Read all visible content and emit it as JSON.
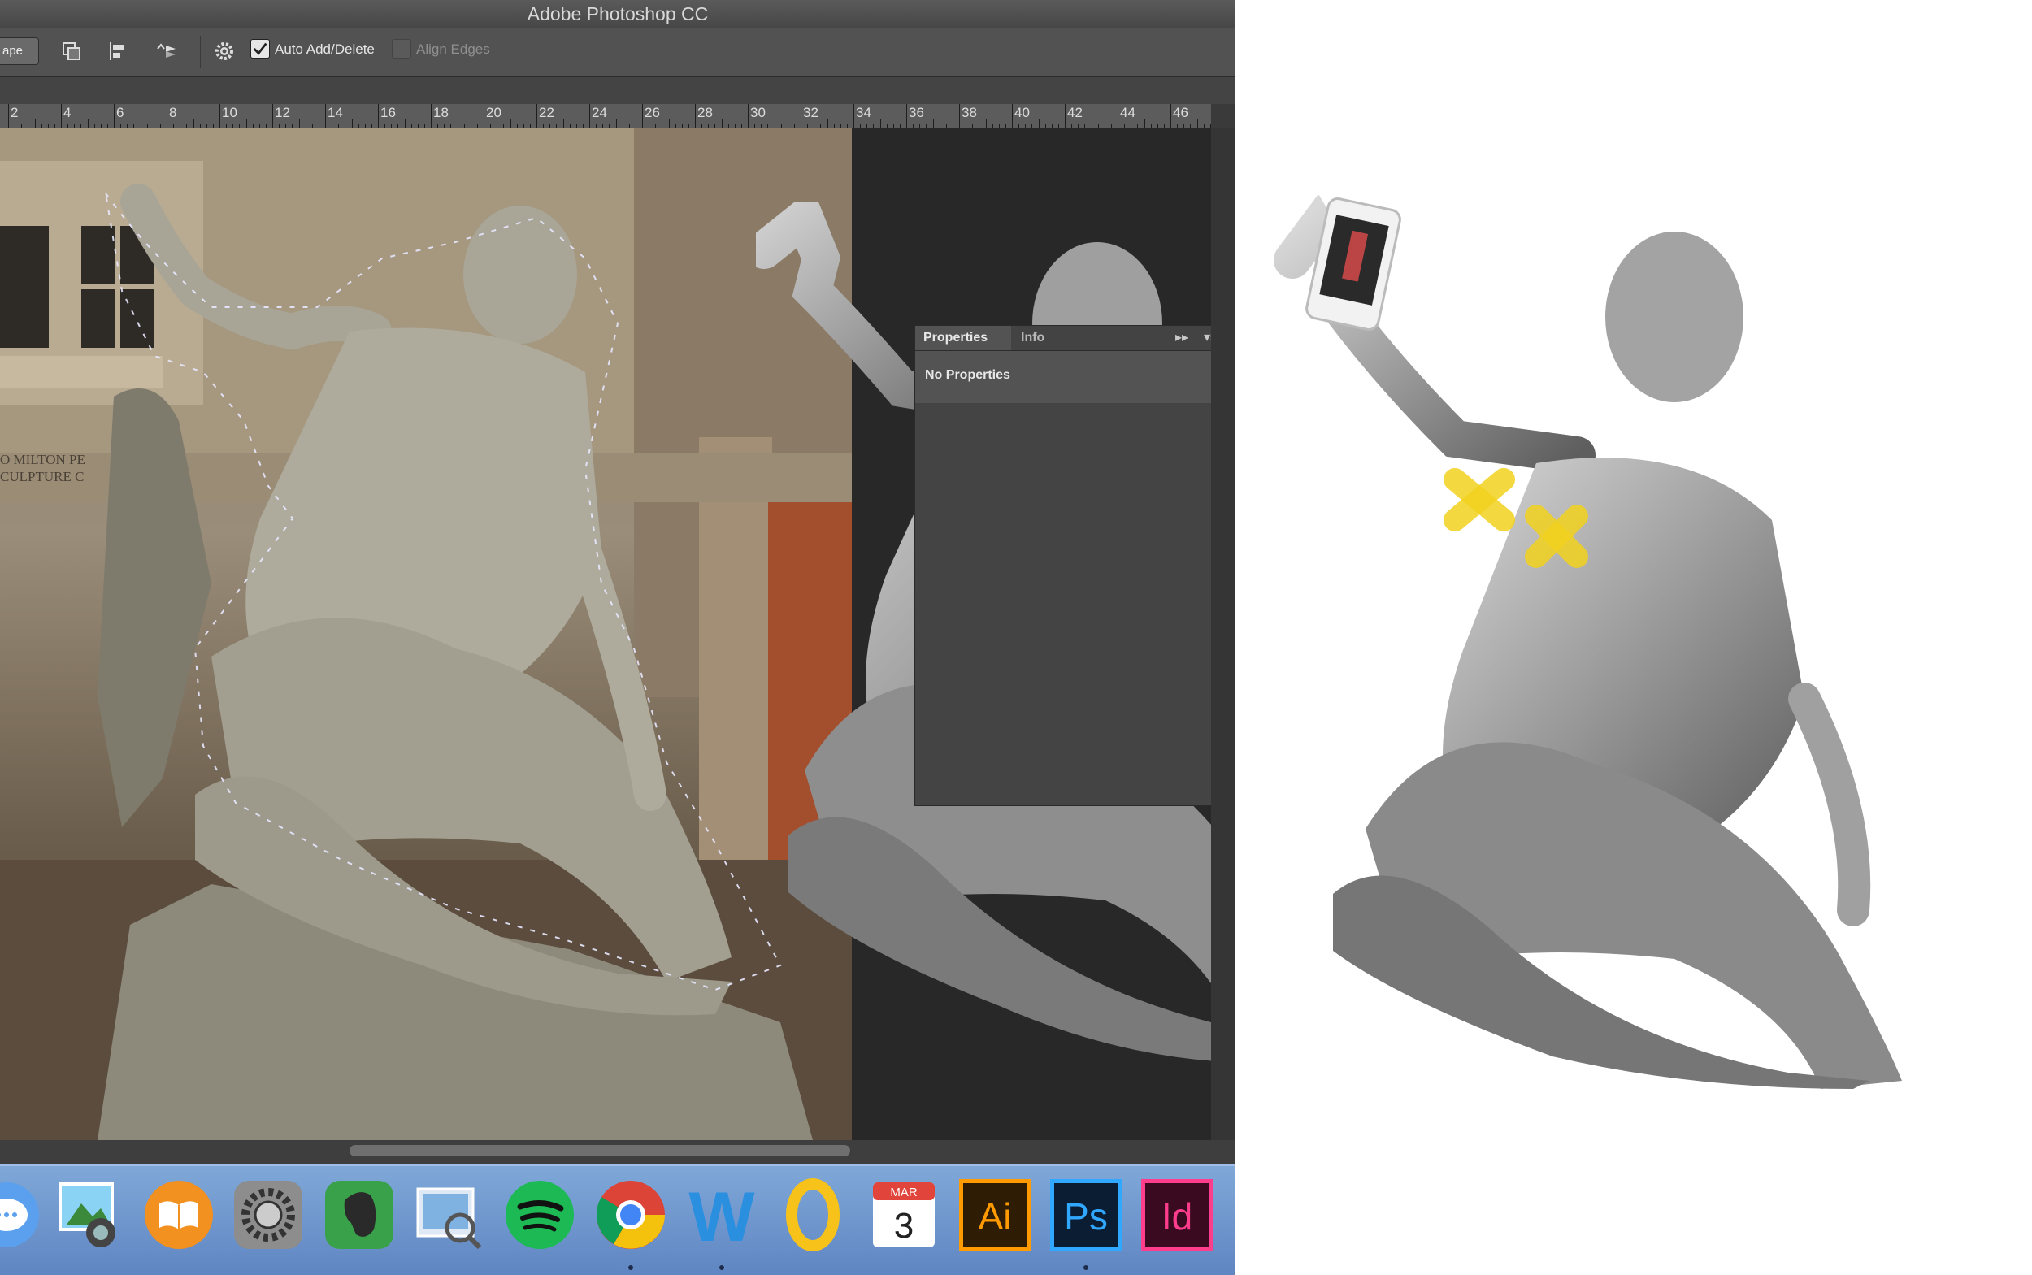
{
  "window": {
    "title": "Adobe Photoshop CC"
  },
  "options_bar": {
    "shape_button_label": "ape",
    "auto_add_delete": {
      "label": "Auto Add/Delete",
      "checked": true
    },
    "align_edges": {
      "label": "Align Edges",
      "checked": false
    }
  },
  "ruler": {
    "labels": [
      "2",
      "4",
      "6",
      "8",
      "10",
      "12",
      "14",
      "16",
      "18",
      "20",
      "22",
      "24",
      "26",
      "28",
      "30",
      "32",
      "34",
      "36",
      "38",
      "40",
      "42",
      "44",
      "46"
    ]
  },
  "canvas_photo": {
    "wall_text_line1": "O MILTON PE",
    "wall_text_line2": "CULPTURE C"
  },
  "properties_panel": {
    "tabs": [
      {
        "label": "Properties",
        "active": true
      },
      {
        "label": "Info",
        "active": false
      }
    ],
    "collapse_glyph": "▸▸",
    "menu_glyph": "▾≡",
    "message": "No Properties"
  },
  "dock": {
    "items": [
      {
        "name": "messages-icon",
        "running": false
      },
      {
        "name": "image-capture-icon",
        "running": false
      },
      {
        "name": "ibooks-icon",
        "running": false
      },
      {
        "name": "system-preferences-icon",
        "running": false
      },
      {
        "name": "evernote-icon",
        "running": false
      },
      {
        "name": "preview-icon",
        "running": false
      },
      {
        "name": "spotify-icon",
        "running": false
      },
      {
        "name": "chrome-icon",
        "running": true
      },
      {
        "name": "word-icon",
        "running": true
      },
      {
        "name": "outlook-icon",
        "running": false
      },
      {
        "name": "calendar-icon",
        "running": false
      },
      {
        "name": "illustrator-icon",
        "running": false
      },
      {
        "name": "photoshop-icon",
        "running": true
      },
      {
        "name": "indesign-icon",
        "running": false
      }
    ],
    "calendar": {
      "month": "MAR",
      "day": "3"
    },
    "illustrator_label": "Ai",
    "photoshop_label": "Ps",
    "indesign_label": "Id",
    "word_label": "W"
  },
  "colors": {
    "ps_ui_dark": "#3a3a3a",
    "dock_blue": "#6f96cd",
    "highlight_yellow": "#f2d21e",
    "illustrator_orange": "#ff9a00",
    "photoshop_blue": "#31a8ff",
    "indesign_pink": "#ff3d8d"
  }
}
